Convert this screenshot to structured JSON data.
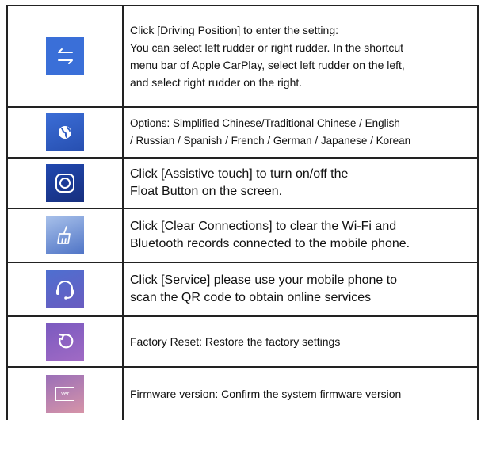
{
  "colors": {
    "border": "#222222",
    "icon_blue": "#3a6fd8",
    "icon_navy": "#1d3f9a",
    "icon_globe": "#2f5cc4",
    "icon_clear": "#5f84cf",
    "icon_service": "#5a67c6",
    "icon_reset": "#8d63c4",
    "icon_ver": "#c48aa6"
  },
  "rows": [
    {
      "icon": "swap-arrows-icon",
      "lines": [
        "Click [Driving Position] to enter the setting:",
        "You can select left rudder or right rudder. In the shortcut",
        "menu bar of Apple CarPlay, select left rudder on the left,",
        "and select right rudder on the right."
      ]
    },
    {
      "icon": "globe-icon",
      "lines": [
        "Options: Simplified Chinese/Traditional Chinese / English",
        "/ Russian / Spanish / French / German / Japanese / Korean"
      ]
    },
    {
      "icon": "assistive-touch-icon",
      "lines": [
        "Click [Assistive touch] to turn on/off the",
        "Float Button on the screen."
      ]
    },
    {
      "icon": "broom-icon",
      "lines": [
        "Click [Clear Connections] to clear the Wi-Fi and",
        "Bluetooth records connected to the mobile phone."
      ]
    },
    {
      "icon": "headset-icon",
      "lines": [
        "Click [Service] please use your mobile phone to",
        "scan the QR code to obtain online services"
      ]
    },
    {
      "icon": "reset-icon",
      "lines": [
        "Factory Reset: Restore the factory settings"
      ]
    },
    {
      "icon": "ver-icon",
      "icon_text": "Ver",
      "lines": [
        "Firmware version: Confirm the system firmware version"
      ]
    }
  ]
}
